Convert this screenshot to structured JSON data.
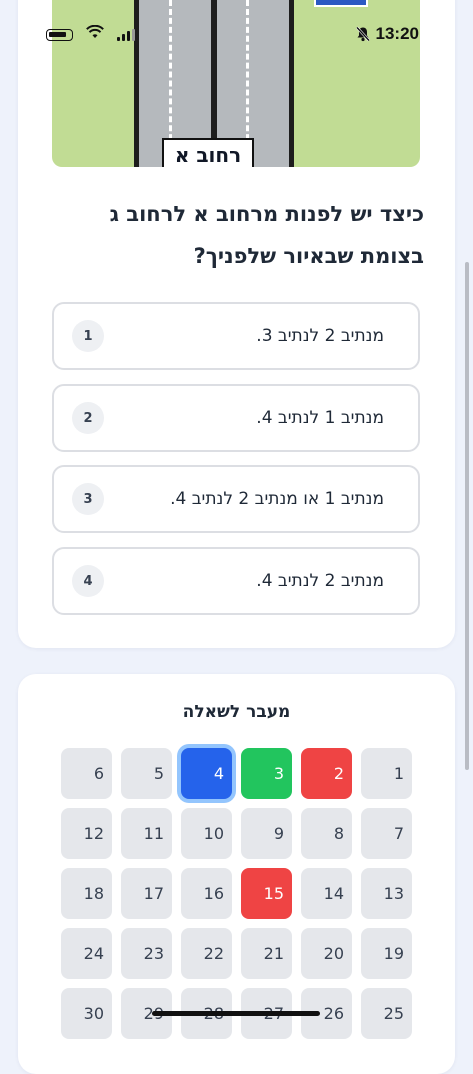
{
  "status_bar": {
    "time": "13:20"
  },
  "image": {
    "street_label": "רחוב א"
  },
  "question": {
    "text": "כיצד יש לפנות מרחוב א לרחוב ג בצומת שבאיור שלפניך?"
  },
  "options": [
    {
      "number": "1",
      "text": "מנתיב 2 לנתיב 3."
    },
    {
      "number": "2",
      "text": "מנתיב 1 לנתיב 4."
    },
    {
      "number": "3",
      "text": "מנתיב 1 או מנתיב 2 לנתיב 4."
    },
    {
      "number": "4",
      "text": "מנתיב 2 לנתיב 4."
    }
  ],
  "navigation": {
    "title": "מעבר לשאלה",
    "questions": [
      {
        "label": "1",
        "state": "default"
      },
      {
        "label": "2",
        "state": "wrong"
      },
      {
        "label": "3",
        "state": "correct"
      },
      {
        "label": "4",
        "state": "current"
      },
      {
        "label": "5",
        "state": "default"
      },
      {
        "label": "6",
        "state": "default"
      },
      {
        "label": "7",
        "state": "default"
      },
      {
        "label": "8",
        "state": "default"
      },
      {
        "label": "9",
        "state": "default"
      },
      {
        "label": "10",
        "state": "default"
      },
      {
        "label": "11",
        "state": "default"
      },
      {
        "label": "12",
        "state": "default"
      },
      {
        "label": "13",
        "state": "default"
      },
      {
        "label": "14",
        "state": "default"
      },
      {
        "label": "15",
        "state": "wrong"
      },
      {
        "label": "16",
        "state": "default"
      },
      {
        "label": "17",
        "state": "default"
      },
      {
        "label": "18",
        "state": "default"
      },
      {
        "label": "19",
        "state": "default"
      },
      {
        "label": "20",
        "state": "default"
      },
      {
        "label": "21",
        "state": "default"
      },
      {
        "label": "22",
        "state": "default"
      },
      {
        "label": "23",
        "state": "default"
      },
      {
        "label": "24",
        "state": "default"
      },
      {
        "label": "25",
        "state": "default"
      },
      {
        "label": "26",
        "state": "default"
      },
      {
        "label": "27",
        "state": "default"
      },
      {
        "label": "28",
        "state": "default"
      },
      {
        "label": "29",
        "state": "default"
      },
      {
        "label": "30",
        "state": "default"
      }
    ]
  },
  "colors": {
    "correct": "#22c55e",
    "wrong": "#ef4444",
    "current": "#2563eb"
  },
  "icons": [
    "bell-slash-icon",
    "battery-icon",
    "wifi-icon",
    "signal-icon"
  ]
}
